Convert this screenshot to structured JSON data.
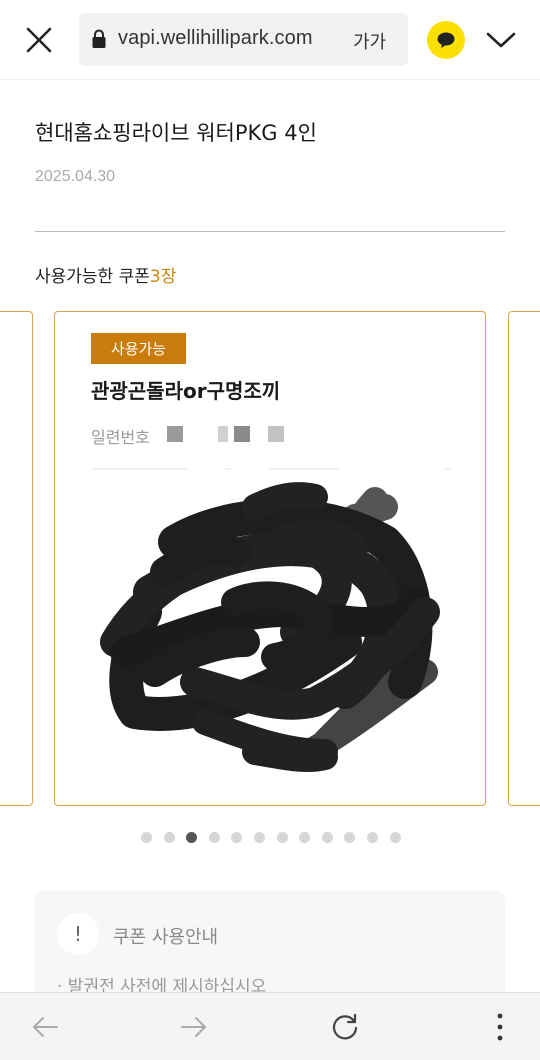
{
  "browser": {
    "url": "vapi.wellihillipark.com",
    "font_size_label": "가가",
    "kakao_color": "#f9e000"
  },
  "header": {
    "title": "현대홈쇼핑라이브 워터PKG 4인",
    "date": "2025.04.30"
  },
  "coupons": {
    "available_label": "사용가능한 쿠폰",
    "available_count": "3장",
    "accent_color": "#c97c0c",
    "card": {
      "status_badge": "사용가능",
      "name": "관광곤돌라or구명조끼",
      "serial_label": "일련번호"
    },
    "pagination": {
      "total": 12,
      "active_index": 2
    }
  },
  "guide": {
    "icon": "exclamation-icon",
    "icon_glyph": "!",
    "title": "쿠폰 사용안내",
    "line1": "· 발권전 사전에 제시하십시오"
  },
  "bottom_nav": {
    "icons": [
      "back-arrow-icon",
      "forward-arrow-icon",
      "reload-icon",
      "more-vertical-icon"
    ]
  }
}
